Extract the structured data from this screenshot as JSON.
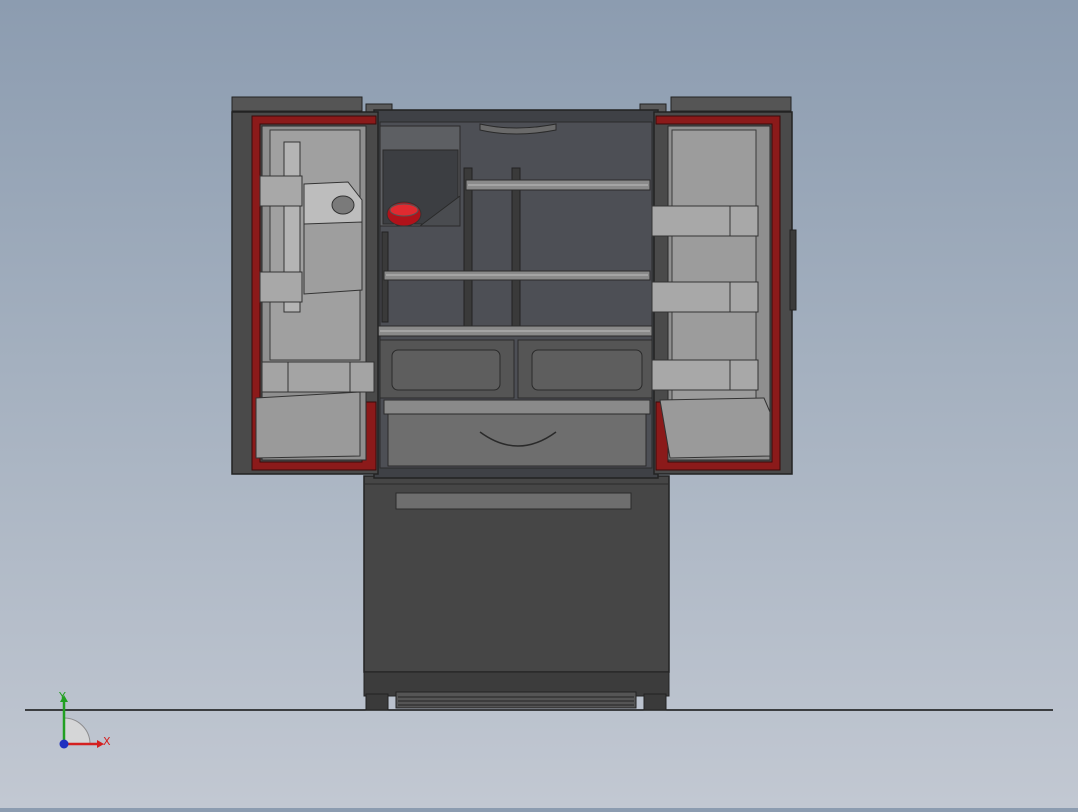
{
  "viewport": {
    "background_top": "#8c9cb0",
    "background_bottom": "#c2c8d2"
  },
  "model": {
    "body_color": "#464646",
    "edge_color": "#2a2a2a",
    "gasket_color": "#8b1a1a",
    "door_panel_color": "#8f8f8f",
    "bin_color": "#9a9a9a",
    "interior_color": "#4d4f55",
    "filter_cap_color": "#c0141c"
  },
  "triad": {
    "x_label": "X",
    "y_label": "Y",
    "x_color": "#d42020",
    "y_color": "#22a022",
    "z_color": "#2030c0"
  }
}
